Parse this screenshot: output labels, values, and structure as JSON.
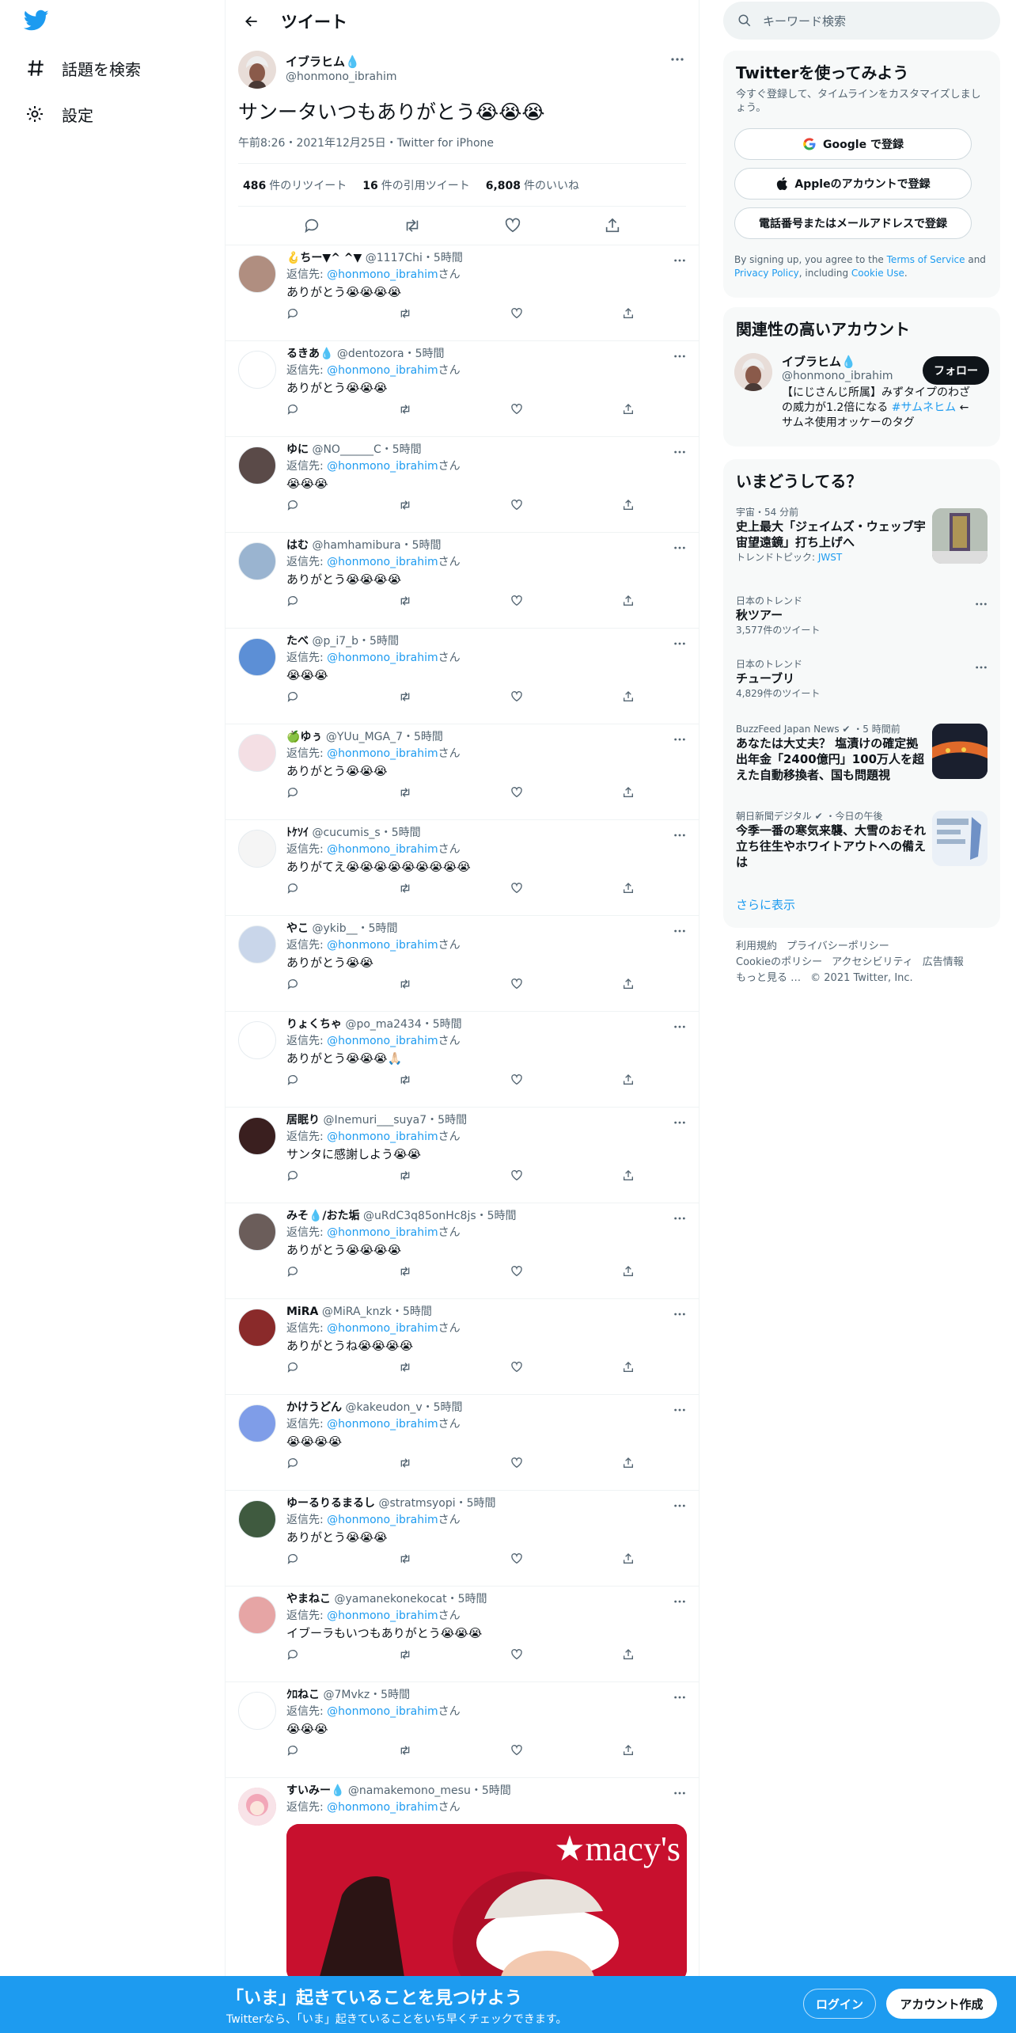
{
  "nav": {
    "explore_label": "話題を検索",
    "settings_label": "設定"
  },
  "header": {
    "title": "ツイート"
  },
  "main_tweet": {
    "name": "イブラヒム💧",
    "handle": "@honmono_ibrahim",
    "text": "サンータいつもありがとう😭😭😭",
    "meta": "午前8:26・2021年12月25日・Twitter for iPhone",
    "stats": [
      {
        "count": "486",
        "label": "件のリツイート"
      },
      {
        "count": "16",
        "label": "件の引用ツイート"
      },
      {
        "count": "6,808",
        "label": "件のいいね"
      }
    ]
  },
  "reply_to_label": "返信先:",
  "reply_to_handle": "@honmono_ibrahim",
  "reply_to_suffix": "さん",
  "replies": [
    {
      "name": "🪝ちー▼^ ^▼",
      "handle": "@1117Chi",
      "time": "・5時間",
      "text": "ありがとう😭😭😭😭",
      "color": "#b08e80"
    },
    {
      "name": "るきあ💧",
      "handle": "@dentozora",
      "time": "・5時間",
      "text": "ありがとう😭😭😭",
      "color": "#ffffff"
    },
    {
      "name": "ゆに",
      "handle": "@NO______C",
      "time": "・5時間",
      "text": "😭😭😭",
      "color": "#5a4a48"
    },
    {
      "name": "はむ",
      "handle": "@hamhamibura",
      "time": "・5時間",
      "text": "ありがとう😭😭😭😭",
      "color": "#9ab4d0"
    },
    {
      "name": "たべ",
      "handle": "@p_i7_b",
      "time": "・5時間",
      "text": "😭😭😭",
      "color": "#5c8fd6"
    },
    {
      "name": "🍏ゆぅ",
      "handle": "@YUu_MGA_7",
      "time": "・5時間",
      "text": "ありがとう😭😭😭",
      "color": "#f4dfe4"
    },
    {
      "name": "ﾄｹｿｲ",
      "handle": "@cucumis_s",
      "time": "・5時間",
      "text": "ありがてえ😭😭😭😭😭😭😭😭😭",
      "color": "#f5f5f5"
    },
    {
      "name": "やこ",
      "handle": "@ykib__",
      "time": "・5時間",
      "text": "ありがとう😭😭",
      "color": "#c9d6ea"
    },
    {
      "name": "りょくちゃ",
      "handle": "@po_ma2434",
      "time": "・5時間",
      "text": "ありがとう😭😭😭🙏🏻",
      "color": "#ffffff"
    },
    {
      "name": "居眠り",
      "handle": "@Inemuri___suya7",
      "time": "・5時間",
      "text": "サンタに感謝しよう😭😭",
      "color": "#3a1f1f"
    },
    {
      "name": "みそ💧/おた垢",
      "handle": "@uRdC3q85onHc8js",
      "time": "・5時間",
      "text": "ありがとう😭😭😭😭",
      "color": "#6b5d5a"
    },
    {
      "name": "MiRA",
      "handle": "@MiRA_knzk",
      "time": "・5時間",
      "text": "ありがとうね😭😭😭😭",
      "color": "#8a2a2a"
    },
    {
      "name": "かけうどん",
      "handle": "@kakeudon_v",
      "time": "・5時間",
      "text": "😭😭😭😭",
      "color": "#7f9de8"
    },
    {
      "name": "ゆーるりるまるし",
      "handle": "@stratmsyopi",
      "time": "・5時間",
      "text": "ありがとう😭😭😭",
      "color": "#3f5a3f"
    },
    {
      "name": "やまねこ",
      "handle": "@yamanekonekocat",
      "time": "・5時間",
      "text": "イブーラもいつもありがとう😭😭😭",
      "color": "#e6a5a5"
    },
    {
      "name": "ｸﾛねこ",
      "handle": "@7Mvkz",
      "time": "・5時間",
      "text": "😭😭😭",
      "color": "#ffffff"
    }
  ],
  "last_reply": {
    "name": "すいみー💧",
    "handle": "@namakemono_mesu",
    "time": "・5時間",
    "image_text": "★macy's",
    "color": "#f0c0cc"
  },
  "sidebar": {
    "search_placeholder": "キーワード検索",
    "signup_title": "Twitterを使ってみよう",
    "signup_sub": "今すぐ登録して、タイムラインをカスタマイズしましょう。",
    "google_btn": "Google で登録",
    "apple_btn": "Appleのアカウントで登録",
    "phone_btn": "電話番号またはメールアドレスで登録",
    "terms_pre": "By signing up, you agree to the ",
    "terms_tos": "Terms of Service",
    "terms_and": " and ",
    "terms_privacy": "Privacy Policy",
    "terms_including": ", including ",
    "terms_cookie": "Cookie Use",
    "terms_end": ".",
    "related_title": "関連性の高いアカウント",
    "related_name": "イブラヒム💧",
    "related_handle": "@honmono_ibrahim",
    "related_bio_1": "【にじさんじ所属】みずタイプのわざの威力が1.2倍になる ",
    "related_bio_tag": "#サムネヒム",
    "related_bio_2": " ←サムネ使用オッケーのタグ",
    "follow_btn": "フォロー",
    "trends_title": "いまどうしてる？",
    "trends": [
      {
        "category": "宇宙・54 分前",
        "title": "史上最大「ジェイムズ・ウェッブ宇宙望遠鏡」打ち上げへ",
        "sub_label": "トレンドトピック: ",
        "sub_link": "JWST"
      },
      {
        "category": "日本のトレンド",
        "title": "秋ツアー",
        "sub": "3,577件のツイート"
      },
      {
        "category": "日本のトレンド",
        "title": "チューブリ",
        "sub": "4,829件のツイート"
      },
      {
        "category": "BuzzFeed Japan News ✔ ・5 時間前",
        "title": "あなたは大丈夫？ 塩漬けの確定拠出年金「2400億円」100万人を超えた自動移換者、国も問題視"
      },
      {
        "category": "朝日新聞デジタル ✔ ・今日の午後",
        "title": "今季一番の寒気来襲、大雪のおそれ　立ち往生やホワイトアウトへの備えは"
      }
    ],
    "show_more": "さらに表示",
    "footer": [
      "利用規約",
      "プライバシーポリシー",
      "Cookieのポリシー",
      "アクセシビリティ",
      "広告情報",
      "もっと見る …",
      "© 2021 Twitter, Inc."
    ]
  },
  "bottom_bar": {
    "title": "「いま」起きていることを見つけよう",
    "subtitle": "Twitterなら、「いま」起きていることをいち早くチェックできます。",
    "login": "ログイン",
    "signup": "アカウント作成"
  },
  "colors": {
    "accent": "#1d9bf0",
    "text": "#0f1419",
    "muted": "#536471"
  }
}
